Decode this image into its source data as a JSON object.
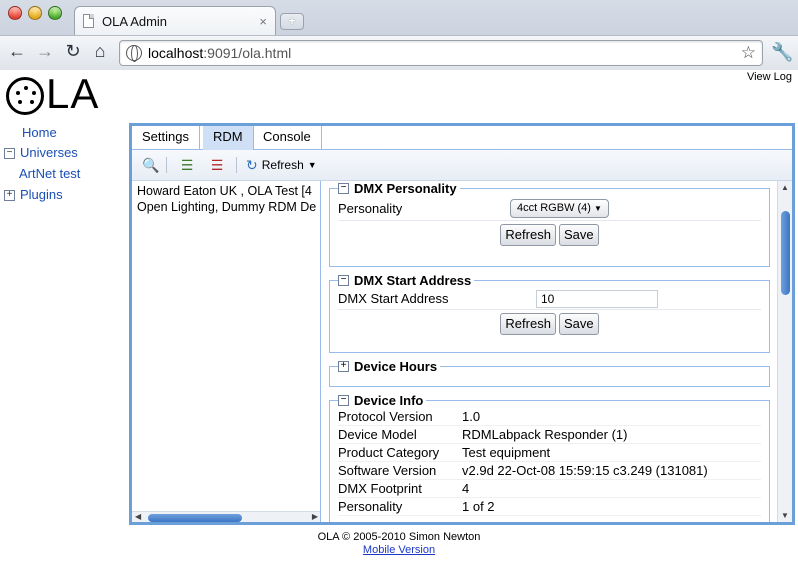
{
  "browser": {
    "tab_title": "OLA Admin",
    "tab_close": "×",
    "new_tab": "+",
    "url_host": "localhost",
    "url_rest": ":9091/ola.html"
  },
  "header": {
    "logo_text": "LA",
    "view_log": "View Log"
  },
  "sidebar": {
    "items": [
      {
        "label": "Home"
      },
      {
        "label": "Universes",
        "expander": "−"
      },
      {
        "label": "ArtNet test"
      },
      {
        "label": "Plugins",
        "expander": "+"
      }
    ]
  },
  "tabs": [
    "Settings",
    "RDM",
    "Console"
  ],
  "toolbar": {
    "refresh_label": "Refresh"
  },
  "devices": [
    "Howard Eaton UK , OLA Test [4",
    "Open Lighting, Dummy RDM De"
  ],
  "sections": {
    "personality": {
      "title": "DMX Personality",
      "toggle": "−",
      "label": "Personality",
      "selected": "4cct RGBW (4)",
      "refresh": "Refresh",
      "save": "Save"
    },
    "start_address": {
      "title": "DMX Start Address",
      "toggle": "−",
      "label": "DMX Start Address",
      "value": "10",
      "refresh": "Refresh",
      "save": "Save"
    },
    "hours": {
      "title": "Device Hours",
      "toggle": "+"
    },
    "info": {
      "title": "Device Info",
      "toggle": "−",
      "rows": [
        {
          "k": "Protocol Version",
          "v": "1.0"
        },
        {
          "k": "Device Model",
          "v": "RDMLabpack Responder (1)"
        },
        {
          "k": "Product Category",
          "v": "Test equipment"
        },
        {
          "k": "Software Version",
          "v": "v2.9d 22-Oct-08 15:59:15 c3.249 (131081)"
        },
        {
          "k": "DMX Footprint",
          "v": "4"
        },
        {
          "k": "Personality",
          "v": "1 of 2"
        }
      ]
    }
  },
  "footer": {
    "copyright": "OLA © 2005-2010 Simon Newton",
    "mobile_link": "Mobile Version"
  }
}
